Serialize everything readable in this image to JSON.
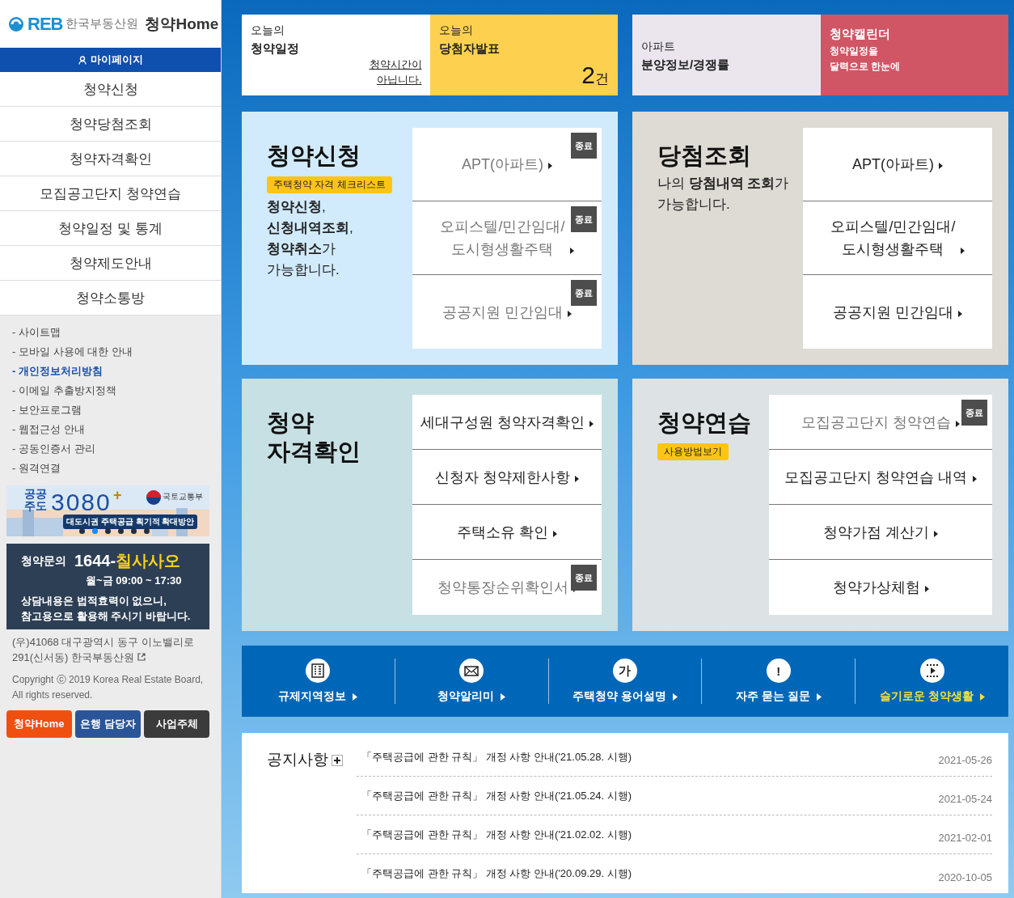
{
  "sidebar": {
    "logo": {
      "mark": "REB",
      "org": "한국부동산원",
      "brand": "청약",
      "brand_suffix": "Home"
    },
    "mypage": "마이페이지",
    "menu": [
      "청약신청",
      "청약당첨조회",
      "청약자격확인",
      "모집공고단지 청약연습",
      "청약일정 및 통계",
      "청약제도안내",
      "청약소통방"
    ],
    "links": [
      {
        "label": "- 사이트맵",
        "selected": false
      },
      {
        "label": "- 모바일 사용에 대한 안내",
        "selected": false
      },
      {
        "label": "- 개인정보처리방침",
        "selected": true
      },
      {
        "label": "- 이메일 추출방지정책",
        "selected": false
      },
      {
        "label": "- 보안프로그램",
        "selected": false
      },
      {
        "label": "- 웹접근성 안내",
        "selected": false
      },
      {
        "label": "- 공동인증서 관리",
        "selected": false
      },
      {
        "label": "- 원격연결",
        "selected": false
      }
    ],
    "banner": {
      "kind": "picture",
      "headline": "공공\n주도",
      "number": "3080",
      "plus": "+",
      "ministry": "국토교통부",
      "caption": "대도시권 주택공급 획기적 확대방안",
      "dots": [
        {
          "selected": false
        },
        {
          "selected": true
        },
        {
          "selected": false
        },
        {
          "selected": false
        },
        {
          "selected": false
        },
        {
          "selected": false
        }
      ]
    },
    "contact": {
      "label": "청약문의",
      "phone": "1644-",
      "phone_word": "칠사사오",
      "hours": "월~금 09:00 ~ 17:30",
      "notice": "상담내용은 법적효력이 없으니,\n참고용으로 활용해 주시기 바랍니다."
    },
    "address": "(우)41068 대구광역시 동구 이노밸리로 291(신서동) 한국부동산원",
    "copyright": "Copyright ⓒ 2019 Korea Real Estate Board, All rights reserved.",
    "buttons": [
      {
        "label": "청약Home",
        "color": "#f0500f"
      },
      {
        "label": "은행 담당자",
        "color": "#2a5599"
      },
      {
        "label": "사업주체",
        "color": "#3b3b3b"
      }
    ]
  },
  "top_cards": [
    {
      "kind": "plain",
      "small": "오늘의",
      "title": "청약일정",
      "link": "청약시간이\n아닙니다."
    },
    {
      "kind": "count",
      "small": "오늘의",
      "title": "당첨자발표",
      "count": "2",
      "unit": "건"
    },
    {
      "kind": "plain",
      "small": "아파트",
      "title": "분양정보/경쟁률"
    },
    {
      "kind": "accent",
      "title": "청약캘린더",
      "subtitle": "청약일정을\n달력으로 한눈에"
    }
  ],
  "panels": [
    {
      "title": "청약신청",
      "tag": "주택청약 자격 체크리스트",
      "description": "**청약신청**,\n**신청내역조회**,\n**청약취소**가\n가능합니다.",
      "links": [
        {
          "label": "APT(아파트)",
          "ended": true,
          "badge": "종료"
        },
        {
          "label": "오피스텔/민간임대/\n도시형생활주택",
          "ended": true,
          "badge": "종료"
        },
        {
          "label": "공공지원 민간임대",
          "ended": true,
          "badge": "종료"
        }
      ]
    },
    {
      "title": "당첨조회",
      "description": "나의 **당첨내역 조회**가\n가능합니다.",
      "links": [
        {
          "label": "APT(아파트)",
          "ended": false
        },
        {
          "label": "오피스텔/민간임대/\n도시형생활주택",
          "ended": false
        },
        {
          "label": "공공지원 민간임대",
          "ended": false
        }
      ]
    },
    {
      "title": "청약\n자격확인",
      "links": [
        {
          "label": "세대구성원 청약자격확인",
          "ended": false
        },
        {
          "label": "신청자 청약제한사항",
          "ended": false
        },
        {
          "label": "주택소유 확인",
          "ended": false
        },
        {
          "label": "청약통장순위확인서",
          "ended": true,
          "badge": "종료"
        }
      ]
    },
    {
      "title": "청약연습",
      "tag": "사용방법보기",
      "links": [
        {
          "label": "모집공고단지 청약연습",
          "ended": true,
          "badge": "종료"
        },
        {
          "label": "모집공고단지 청약연습 내역",
          "ended": false
        },
        {
          "label": "청약가점 계산기",
          "ended": false
        },
        {
          "label": "청약가상체험",
          "ended": false
        }
      ]
    }
  ],
  "quick_links": [
    {
      "kind": "building",
      "label": "규제지역정보",
      "highlight": false
    },
    {
      "kind": "mail",
      "label": "청약알리미",
      "highlight": false
    },
    {
      "kind": "glyph",
      "glyph": "가",
      "label": "주택청약 용어설명",
      "highlight": false
    },
    {
      "kind": "glyph",
      "glyph": "!",
      "label": "자주 묻는 질문",
      "highlight": false
    },
    {
      "kind": "film",
      "label": "슬기로운 청약생활",
      "highlight": true
    }
  ],
  "notices": {
    "title": "공지사항",
    "rows": [
      {
        "text": "「주택공급에 관한 규칙」 개정 사항 안내('21.05.28. 시행)",
        "date": "2021-05-26"
      },
      {
        "text": "「주택공급에 관한 규칙」 개정 사항 안내('21.05.24. 시행)",
        "date": "2021-05-24"
      },
      {
        "text": "「주택공급에 관한 규칙」 개정 사항 안내('21.02.02. 시행)",
        "date": "2021-02-01"
      },
      {
        "text": "「주택공급에 관한 규칙」 개정 사항 안내('20.09.29. 시행)",
        "date": "2020-10-05"
      }
    ]
  }
}
